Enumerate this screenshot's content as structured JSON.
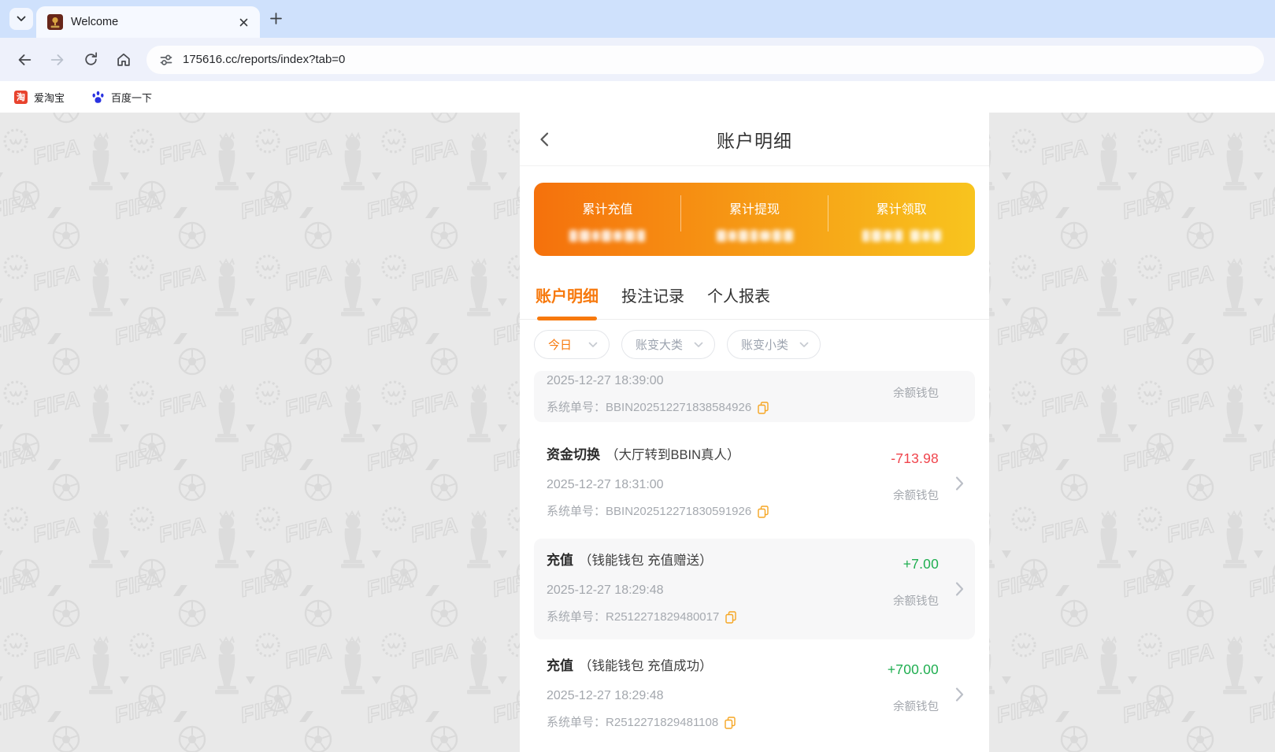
{
  "browser": {
    "tab_title": "Welcome",
    "url": "175616.cc/reports/index?tab=0",
    "bookmarks": [
      {
        "label": "爱淘宝"
      },
      {
        "label": "百度一下"
      }
    ],
    "icons": [
      "tab-search-chevron",
      "favicon",
      "close-icon",
      "new-tab-plus",
      "back-arrow",
      "forward-arrow",
      "reload-icon",
      "home-icon",
      "site-info-tune-icon",
      "taobao-icon",
      "baidu-icon"
    ]
  },
  "page": {
    "header": {
      "title": "账户明细",
      "back_icon": "chevron-left"
    },
    "summary": {
      "items": [
        {
          "label": "累计充值"
        },
        {
          "label": "累计提现"
        },
        {
          "label": "累计领取"
        }
      ],
      "values_masked": true
    },
    "tabs": [
      {
        "label": "账户明细",
        "active": true
      },
      {
        "label": "投注记录",
        "active": false
      },
      {
        "label": "个人报表",
        "active": false
      }
    ],
    "filters": [
      {
        "label": "今日",
        "active": true
      },
      {
        "label": "账变大类",
        "active": false
      },
      {
        "label": "账变小类",
        "active": false
      }
    ],
    "order_label": "系统单号：",
    "rows": [
      {
        "datetime": "2025-12-27 18:39:00",
        "order_no": "BBIN202512271838584926",
        "wallet": "余额钱包"
      },
      {
        "title": "资金切换",
        "subtitle": "（大厅转到BBIN真人）",
        "datetime": "2025-12-27 18:31:00",
        "order_no": "BBIN202512271830591926",
        "amount": "-713.98",
        "wallet": "余额钱包"
      },
      {
        "title": "充值",
        "subtitle": "（钱能钱包 充值赠送）",
        "datetime": "2025-12-27 18:29:48",
        "order_no": "R2512271829480017",
        "amount": "+7.00",
        "wallet": "余额钱包"
      },
      {
        "title": "充值",
        "subtitle": "（钱能钱包 充值成功）",
        "datetime": "2025-12-27 18:29:48",
        "order_no": "R2512271829481108",
        "amount": "+700.00",
        "wallet": "余额钱包"
      }
    ]
  },
  "colors": {
    "accent_orange": "#f7790d",
    "card_gradient_start": "#f5710c",
    "card_gradient_end": "#f8c41e",
    "amount_negative": "#f0444c",
    "amount_positive": "#1fae50",
    "copy_icon_orange": "#f6a623",
    "tabstrip_blue": "#cfe1fc",
    "toolbar_lavender": "#eef1fb",
    "page_background": "#e9e9e9"
  }
}
